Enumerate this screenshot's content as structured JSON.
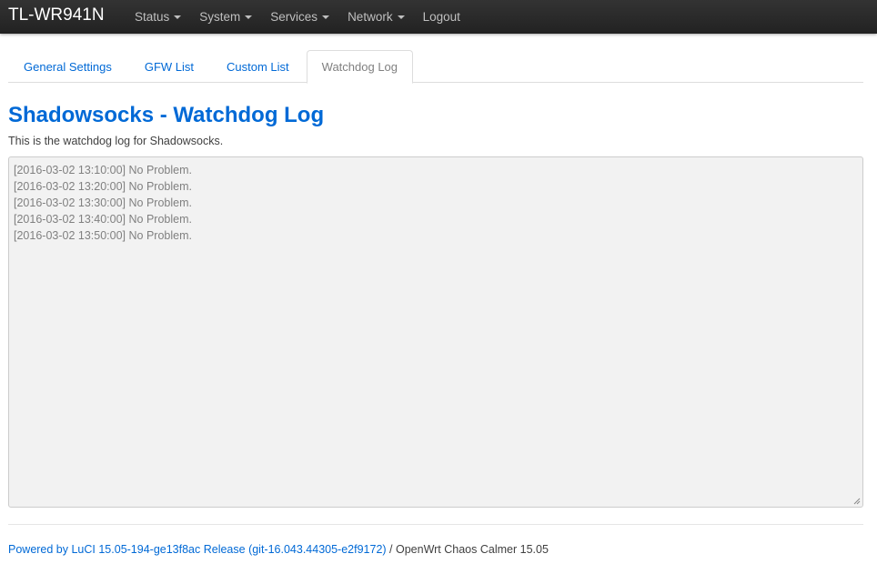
{
  "navbar": {
    "brand": "TL-WR941N",
    "items": [
      {
        "label": "Status",
        "has_dropdown": true
      },
      {
        "label": "System",
        "has_dropdown": true
      },
      {
        "label": "Services",
        "has_dropdown": true
      },
      {
        "label": "Network",
        "has_dropdown": true
      },
      {
        "label": "Logout",
        "has_dropdown": false
      }
    ]
  },
  "tabs": [
    {
      "label": "General Settings",
      "active": false
    },
    {
      "label": "GFW List",
      "active": false
    },
    {
      "label": "Custom List",
      "active": false
    },
    {
      "label": "Watchdog Log",
      "active": true
    }
  ],
  "page": {
    "title": "Shadowsocks - Watchdog Log",
    "description": "This is the watchdog log for Shadowsocks."
  },
  "log": {
    "lines": [
      "[2016-03-02 13:10:00] No Problem.",
      "[2016-03-02 13:20:00] No Problem.",
      "[2016-03-02 13:30:00] No Problem.",
      "[2016-03-02 13:40:00] No Problem.",
      "[2016-03-02 13:50:00] No Problem."
    ]
  },
  "footer": {
    "link_text": "Powered by LuCI 15.05-194-ge13f8ac Release (git-16.043.44305-e2f9172)",
    "suffix": " / OpenWrt Chaos Calmer 15.05"
  },
  "colors": {
    "navbar_bg": "#222222",
    "link": "#0069d6",
    "log_bg": "#f2f2f2"
  }
}
